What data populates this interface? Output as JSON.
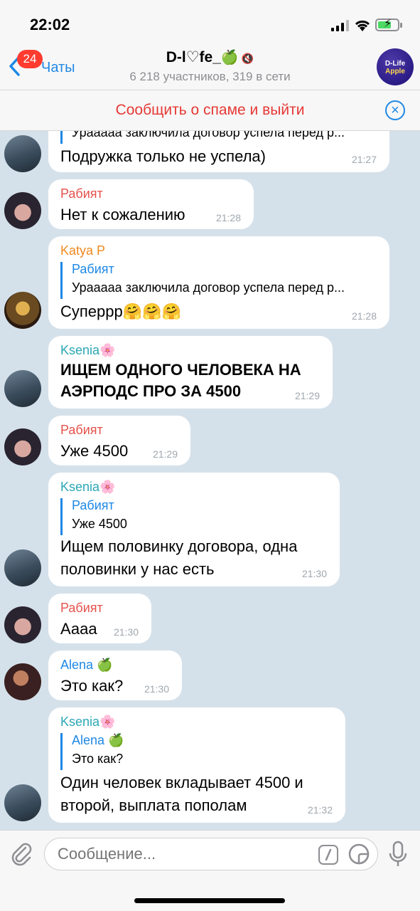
{
  "status_bar": {
    "time": "22:02"
  },
  "nav": {
    "back_badge": "24",
    "back_label": "Чаты",
    "title": "D-l♡fe_",
    "title_emoji": "🍏",
    "subtitle": "6 218 участников, 319 в сети",
    "group_avatar_line1": "D-Life",
    "group_avatar_line2": "Apple"
  },
  "spam_bar": {
    "text": "Сообщить о спаме и выйти"
  },
  "messages": [
    {
      "reply_text": "Урааааа заключила договор успела перед р...",
      "text": "Подружка только не успела)",
      "time": "21:27"
    },
    {
      "sender": "Рабият",
      "text": "Нет к сожалению",
      "time": "21:28"
    },
    {
      "sender": "Katya P",
      "reply_name": "Рабият",
      "reply_text": "Урааааа заключила договор успела перед р...",
      "text": "Суперрр🤗🤗🤗",
      "time": "21:28"
    },
    {
      "sender": "Ksenia🌸",
      "text_line1": "ИЩЕМ ОДНОГО ЧЕЛОВЕКА НА",
      "text_line2": "АЭРПОДС ПРО  ЗА 4500",
      "time": "21:29"
    },
    {
      "sender": "Рабият",
      "text": "Уже 4500",
      "time": "21:29"
    },
    {
      "sender": "Ksenia🌸",
      "reply_name": "Рабият",
      "reply_text": "Уже 4500",
      "text_line1": "Ищем половинку договора, одна",
      "text_line2": "половинки у нас есть",
      "time": "21:30"
    },
    {
      "sender": "Рабият",
      "text": "Аааа",
      "time": "21:30"
    },
    {
      "sender": "Alena 🍏",
      "text": "Это как?",
      "time": "21:30"
    },
    {
      "sender": "Ksenia🌸",
      "reply_name": "Alena 🍏",
      "reply_text": "Это как?",
      "text_line1": "Один человек вкладывает 4500 и",
      "text_line2": "второй,  выплата пополам",
      "time": "21:32"
    }
  ],
  "colors": {
    "rabiyat": "#e5514b",
    "katya": "#ef8a21",
    "ksenia": "#2aa7b5",
    "alena": "#1e88e5",
    "accent": "#1e88e5",
    "spam": "#e53935"
  },
  "input": {
    "placeholder": "Сообщение..."
  },
  "icons": [
    "chevron-left-icon",
    "mute-icon",
    "close-icon",
    "paperclip-icon",
    "command-icon",
    "sticker-icon",
    "microphone-icon"
  ]
}
